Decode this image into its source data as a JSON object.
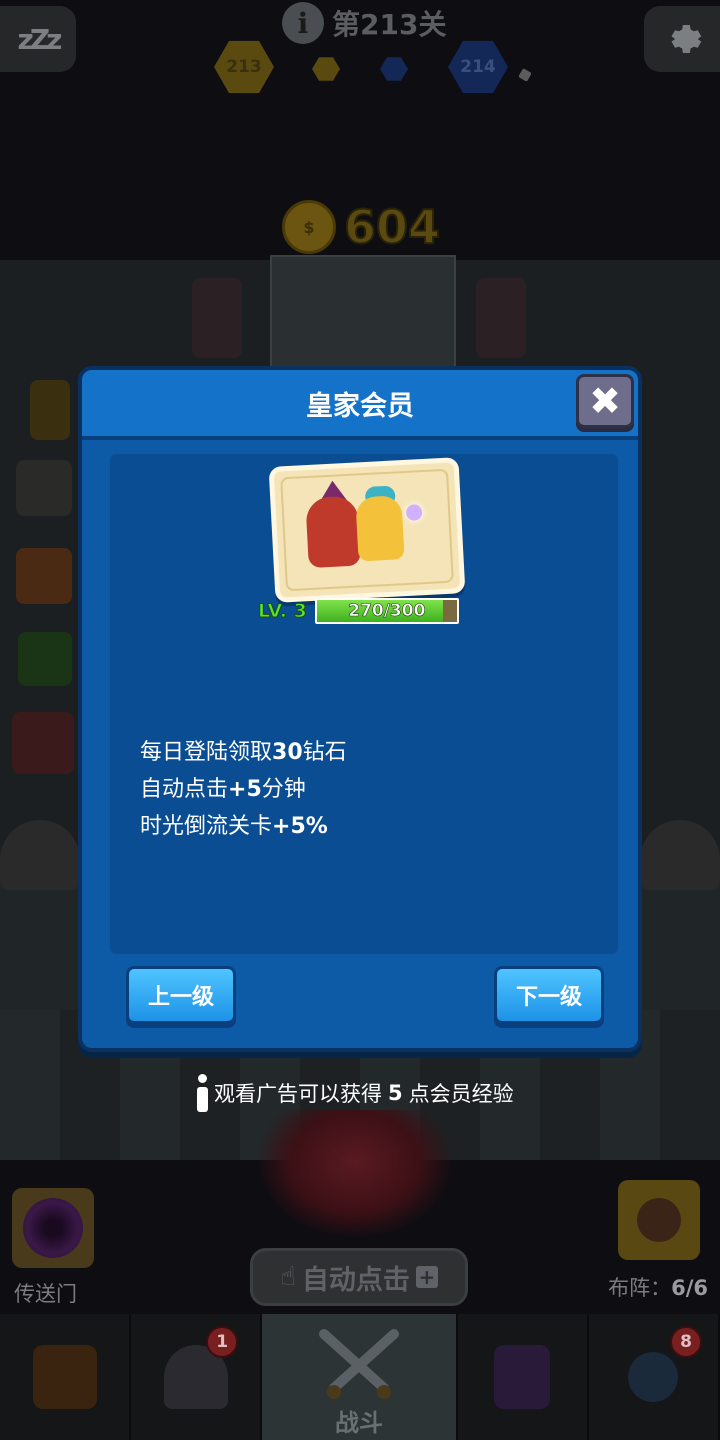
{
  "hud": {
    "level_label": "第213关",
    "current_stage": "213",
    "next_stage": "214",
    "gold": "604"
  },
  "modal": {
    "title": "皇家会员",
    "close_symbol": "✖",
    "level_tag": "LV. 3",
    "xp_text": "270/300",
    "xp_fraction": 0.9,
    "benefits": [
      {
        "prefix": "每日登陆领取",
        "num": "30",
        "suffix": "钻石"
      },
      {
        "prefix": "自动点击",
        "num": "+5",
        "suffix": "分钟"
      },
      {
        "prefix": "时光倒流关卡",
        "num": "+5%",
        "suffix": ""
      }
    ],
    "prev_label": "上一级",
    "next_label": "下一级"
  },
  "ad_hint": {
    "prefix": "观看广告可以获得",
    "num": "5",
    "suffix": "点会员经验"
  },
  "bottom": {
    "portal_label": "传送门",
    "auto_click_label": "自动点击",
    "formation_prefix": "布阵：",
    "formation_value": "6/6",
    "battle_label": "战斗",
    "badges": {
      "helmet": "1",
      "amulet": "8"
    }
  },
  "colors": {
    "modal_blue": "#0d5aa7",
    "header_blue": "#1473c9",
    "button_blue": "#1e92e6",
    "xp_green": "#3fb020",
    "level_green": "#58e629"
  },
  "icons": [
    "sleep-icon",
    "gear-icon",
    "info-icon",
    "coin-icon",
    "close-icon",
    "portal-icon",
    "hand-icon",
    "plus-icon",
    "chest-icon",
    "helmet-icon",
    "swords-icon",
    "spellbook-icon",
    "amulet-icon",
    "membership-card-icon"
  ]
}
